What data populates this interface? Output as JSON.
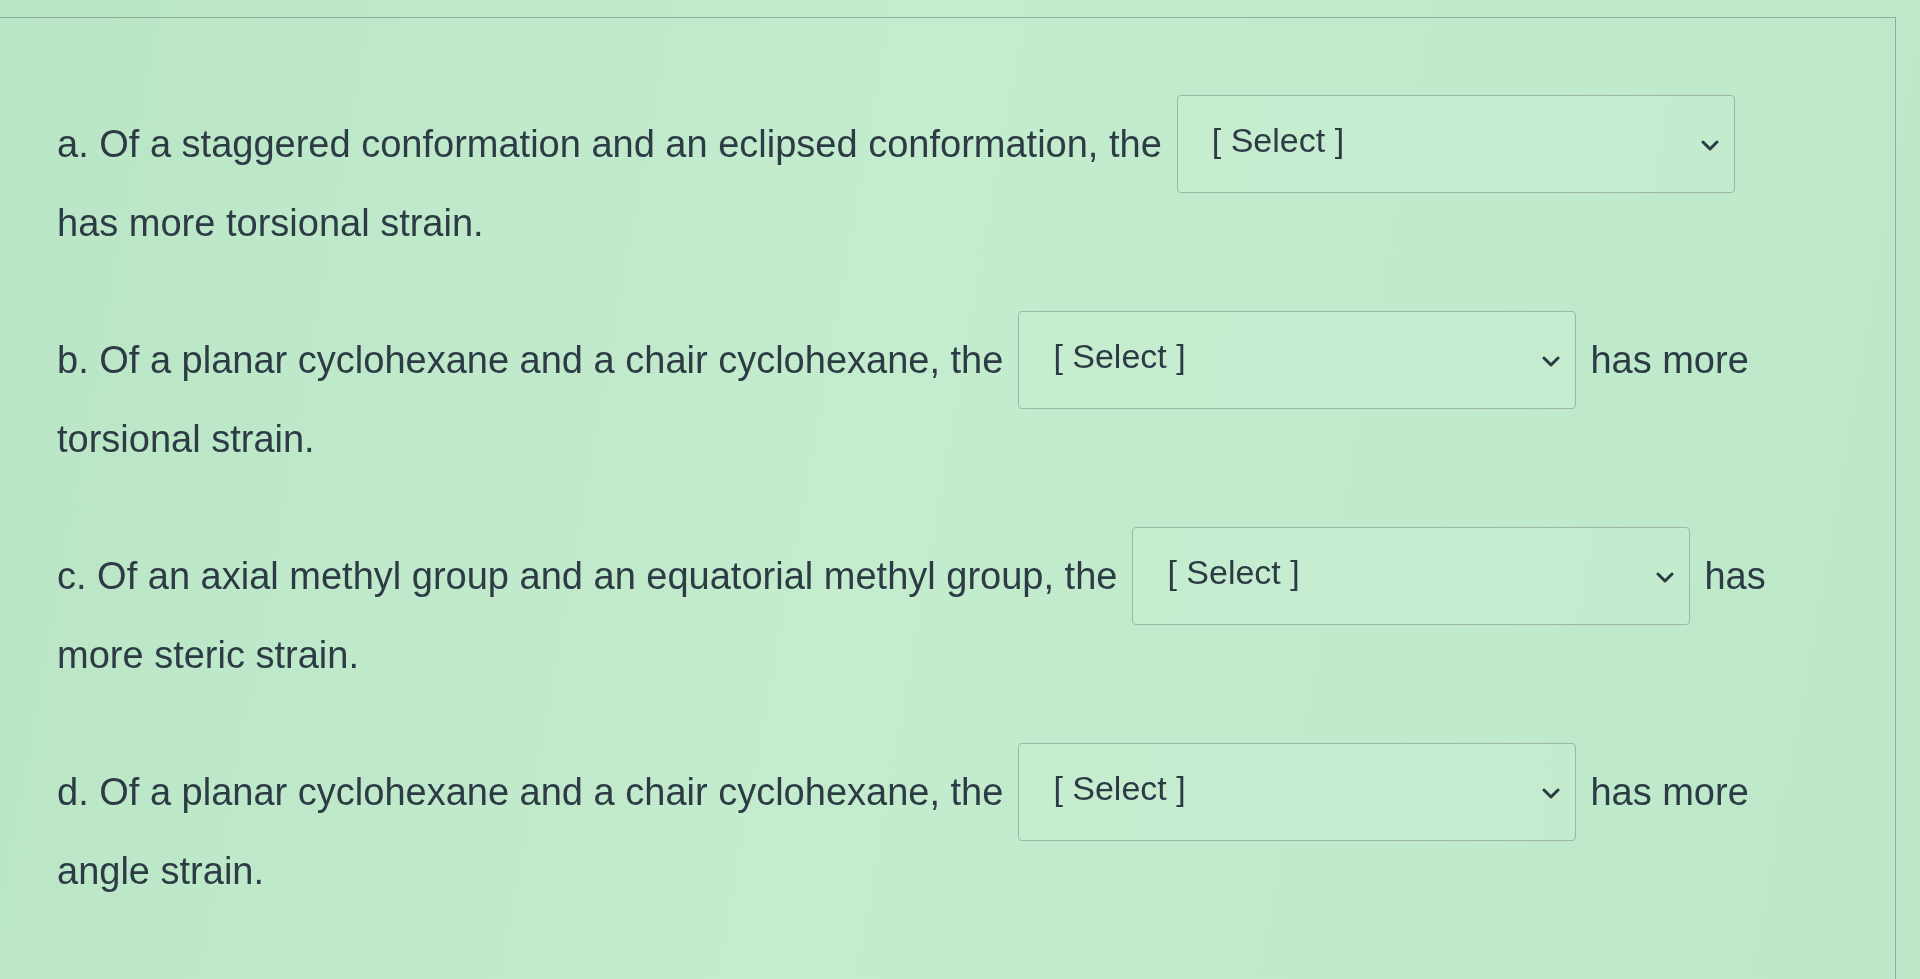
{
  "questions": [
    {
      "text": "a. Of a staggered conformation and an eclipsed conformation, the",
      "dropdown": {
        "value": "[ Select ]"
      },
      "next_line": "has more torsional strain."
    },
    {
      "text": "b. Of a planar cyclohexane and a chair cyclohexane, the",
      "dropdown": {
        "value": "[ Select ]"
      },
      "text_after_dropdown": "has more",
      "next_line": "torsional strain."
    },
    {
      "text": "c. Of an axial methyl group and an equatorial methyl group, the",
      "dropdown": {
        "value": "[ Select ]"
      },
      "text_after_dropdown": "has",
      "next_line": "more steric strain."
    },
    {
      "text": "d. Of a planar cyclohexane and a chair cyclohexane, the",
      "dropdown": {
        "value": "[ Select ]"
      },
      "text_after_dropdown": "has more",
      "next_line": "angle strain."
    }
  ]
}
